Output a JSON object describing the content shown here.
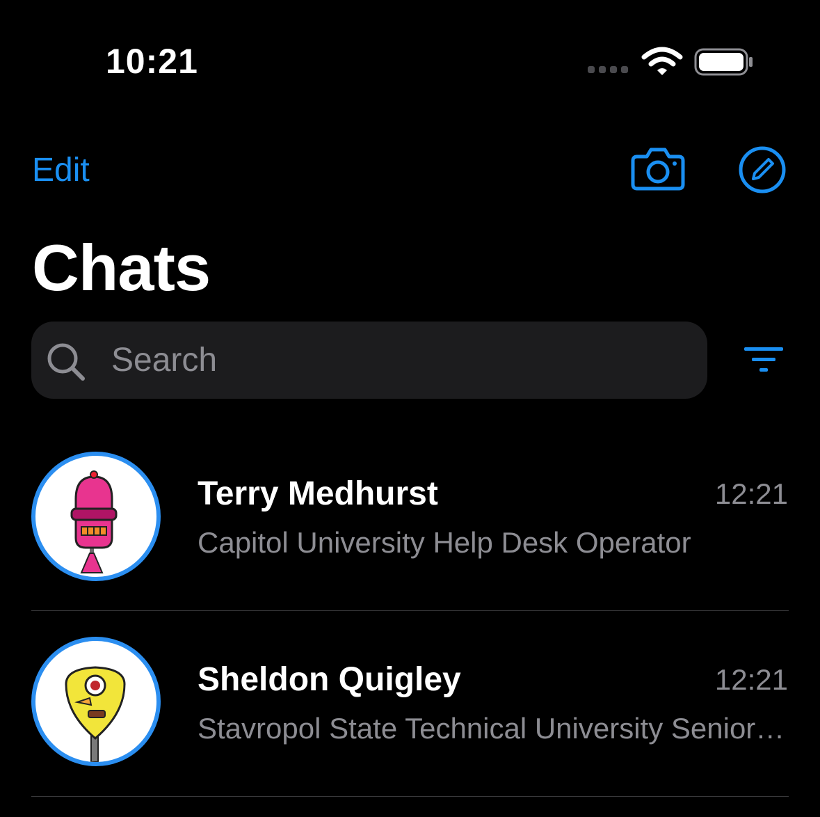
{
  "status_bar": {
    "time": "10:21",
    "icons": [
      "cellular-signal-icon",
      "wifi-icon",
      "battery-icon"
    ]
  },
  "nav": {
    "edit_label": "Edit",
    "actions": [
      "camera-icon",
      "compose-icon"
    ]
  },
  "page_title": "Chats",
  "search": {
    "placeholder": "Search",
    "value": "",
    "filter_icon": "filter-icon"
  },
  "chats": [
    {
      "name": "Terry Medhurst",
      "time": "12:21",
      "preview": "Capitol University Help Desk Operator",
      "avatar": "pink-robot-avatar"
    },
    {
      "name": "Sheldon Quigley",
      "time": "12:21",
      "preview": "Stavropol State Technical University Senior Cost Accountant",
      "avatar": "yellow-robot-avatar"
    }
  ],
  "colors": {
    "background": "#000000",
    "accent": "#1a8ff2",
    "avatar_ring": "#2b8ef0",
    "search_field": "#1c1c1e",
    "secondary_text": "#8d8d93",
    "divider": "#38383a"
  }
}
